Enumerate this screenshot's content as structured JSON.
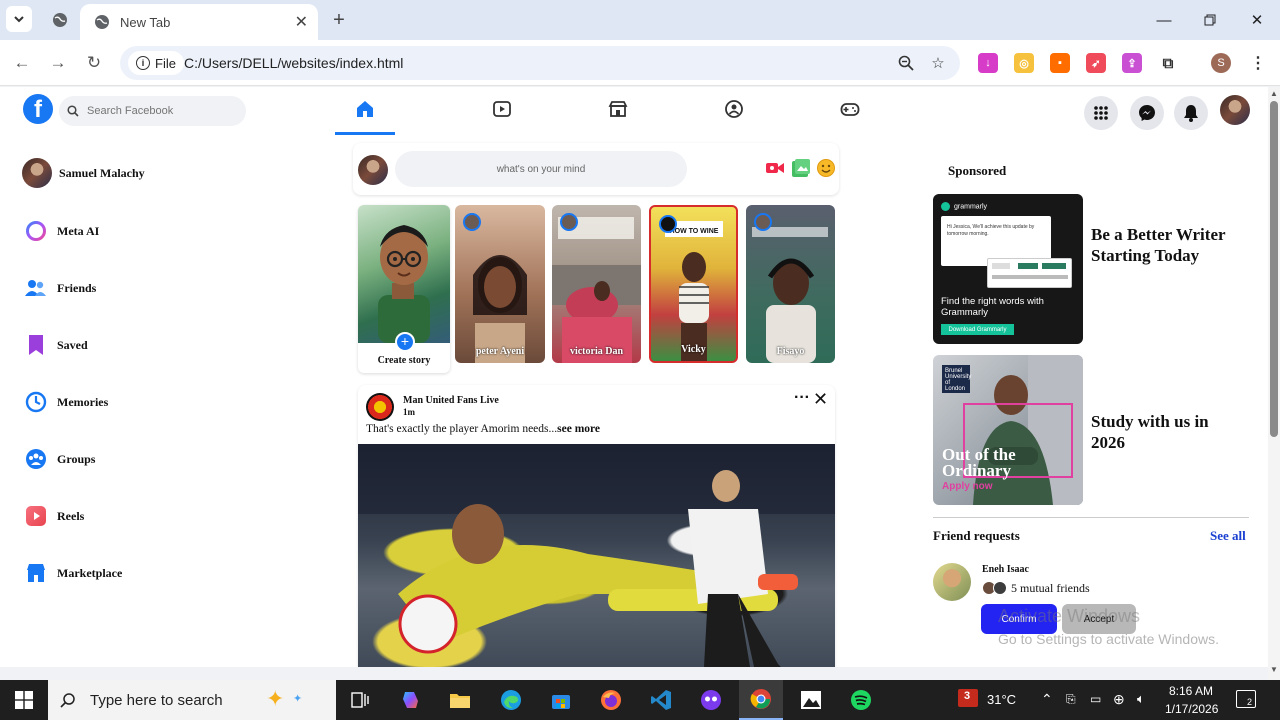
{
  "browser": {
    "tab_title": "New Tab",
    "address_label": "File",
    "url": "C:/Users/DELL/websites/index.html",
    "profile_initial": "S"
  },
  "facebook": {
    "search_placeholder": "Search Facebook",
    "user_name": "Samuel Malachy",
    "left_nav": [
      {
        "label": "Meta AI",
        "icon": "meta-ai-icon"
      },
      {
        "label": "Friends",
        "icon": "friends-icon"
      },
      {
        "label": "Saved",
        "icon": "bookmark-icon"
      },
      {
        "label": "Memories",
        "icon": "clock-icon"
      },
      {
        "label": "Groups",
        "icon": "groups-icon"
      },
      {
        "label": "Reels",
        "icon": "reels-icon"
      },
      {
        "label": "Marketplace",
        "icon": "shop-icon"
      }
    ],
    "composer_placeholder": "what's on your mind",
    "stories": {
      "create_label": "Create story",
      "items": [
        {
          "name": "peter Ayeni",
          "color_top": "#d9b8a0",
          "color_bottom": "#6b4a3a"
        },
        {
          "name": "victoria Dan",
          "color_top": "#bfb6ad",
          "color_bottom": "#b23a48"
        },
        {
          "name": "Vicky",
          "color_top": "#f3e05a",
          "color_bottom": "#3c8f43"
        },
        {
          "name": "Fisayo",
          "color_top": "#5a5f6e",
          "color_bottom": "#2f6b58"
        }
      ]
    },
    "post": {
      "author": "Man United Fans Live",
      "time": "1m",
      "text": "That's exactly the player Amorim needs...",
      "see_more": "see more"
    },
    "sponsored": {
      "heading": "Sponsored",
      "ad1": {
        "brand": "grammarly",
        "image_title": "Find the right words with Grammarly",
        "image_button": "Download Grammarly",
        "card_text": "Hi Jessica, We'll achieve this update by tomorrow morning.",
        "text": "Be a Better Writer Starting Today"
      },
      "ad2": {
        "logo": "Brunel University of London",
        "image_heading": "Out of the Ordinary",
        "image_sub": "Apply now",
        "text": "Study with us in 2026"
      }
    },
    "friend_requests": {
      "title": "Friend requests",
      "see_all": "See all",
      "name": "Eneh Isaac",
      "mutual": "5 mutual friends",
      "confirm": "Confirm",
      "accept": "Accept"
    },
    "watermark": {
      "line1": "Activate Windows",
      "line2": "Go to Settings to activate Windows."
    }
  },
  "taskbar": {
    "search_placeholder": "Type here to search",
    "weather": "31°C",
    "time": "8:16 AM",
    "date": "1/17/2026",
    "notification_count": "2",
    "weather_badge": "3"
  }
}
